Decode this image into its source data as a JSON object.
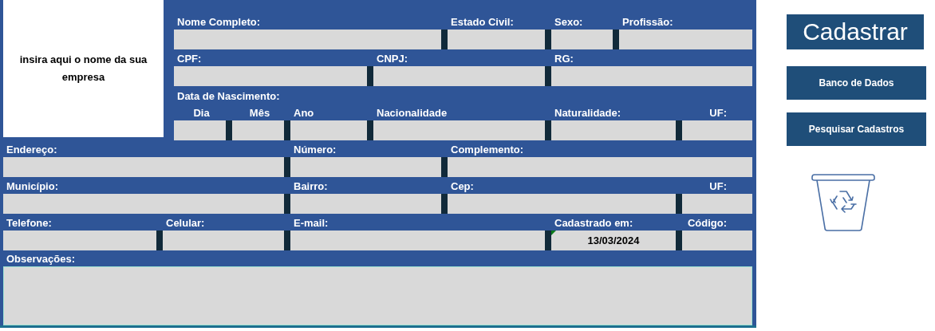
{
  "logo_placeholder": "insira aqui o nome da sua empresa",
  "top_rows": [
    [
      {
        "label": "Nome Completo:"
      },
      {
        "label": "Estado Civil:"
      },
      {
        "label": "Sexo:"
      },
      {
        "label": "Profissão:"
      }
    ],
    [
      {
        "label": "CPF:"
      },
      {
        "label": "CNPJ:"
      },
      {
        "label": "RG:"
      }
    ],
    [
      {
        "label": "Dia"
      },
      {
        "label": "Mês"
      },
      {
        "label": "Ano"
      },
      {
        "label": "Nacionalidade"
      },
      {
        "label": "Naturalidade:"
      },
      {
        "label": "UF:"
      }
    ]
  ],
  "birth_date_heading": "Data de Nascimento:",
  "bottom_rows": [
    [
      {
        "label": "Endereço:"
      },
      {
        "label": "Número:"
      },
      {
        "label": "Complemento:"
      }
    ],
    [
      {
        "label": "Município:"
      },
      {
        "label": "Bairro:"
      },
      {
        "label": "Cep:"
      },
      {
        "label": "UF:"
      }
    ],
    [
      {
        "label": "Telefone:"
      },
      {
        "label": "Celular:"
      },
      {
        "label": "E-mail:"
      },
      {
        "label": "Cadastrado em:",
        "value": "13/03/2024"
      },
      {
        "label": "Código:"
      }
    ]
  ],
  "notes": {
    "label": "Observações:"
  },
  "buttons": [
    {
      "label": "Cadastrar",
      "kind": "primary"
    },
    {
      "label": "Banco de Dados",
      "kind": "secondary"
    },
    {
      "label": "Pesquisar Cadastros",
      "kind": "secondary"
    }
  ]
}
